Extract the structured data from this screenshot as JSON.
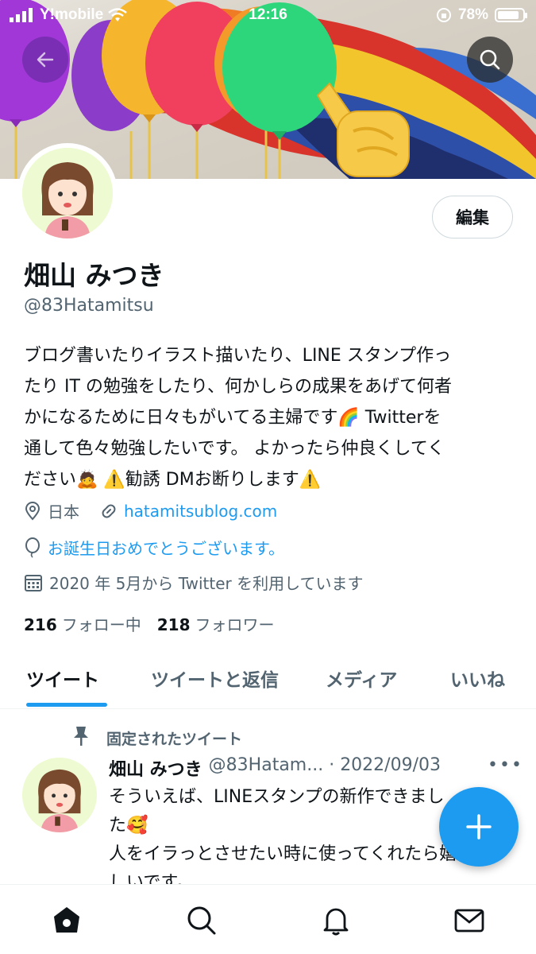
{
  "status": {
    "carrier": "Y!mobile",
    "time": "12:16",
    "battery": "78%",
    "battery_level": 0.78
  },
  "profile": {
    "name": "畑山 みつき",
    "handle": "@83Hatamitsu",
    "edit_label": "編集",
    "bio_lines": [
      "ブログ書いたりイラスト描いたり、LINE スタンプ作っ",
      "たり IT の勉強をしたり、何かしらの成果をあげて何者",
      "かになるために日々もがいてる主婦です🌈 Twitterを",
      "通して色々勉強したいです。 よかったら仲良くしてく",
      "ださい🙇 ⚠️勧誘 DMお断りします⚠️"
    ],
    "location": "日本",
    "website": "hatamitsublog.com",
    "birthday": "お誕生日おめでとうございます。",
    "joined": "2020 年 5月から Twitter を利用しています",
    "following_count": "216",
    "following_label": "フォロー中",
    "followers_count": "218",
    "followers_label": "フォロワー"
  },
  "tabs": [
    {
      "label": "ツイート",
      "active": true
    },
    {
      "label": "ツイートと返信",
      "active": false
    },
    {
      "label": "メディア",
      "active": false
    },
    {
      "label": "いいね",
      "active": false
    }
  ],
  "tweet": {
    "pinned_label": "固定されたツイート",
    "name": "畑山 みつき",
    "handle_date": "@83Hatam... · 2022/09/03",
    "more": "•••",
    "lines": [
      "そういえば、LINEスタンプの新作できまし",
      "た🥰",
      "人をイラっとさせたい時に使ってくれたら嬉",
      "しいです。"
    ]
  },
  "icons": {
    "back": "back-arrow-icon",
    "search": "search-icon",
    "location": "location-pin-icon",
    "link": "link-icon",
    "balloon": "balloon-icon",
    "calendar": "calendar-icon",
    "pin": "pin-icon",
    "compose": "plus-icon",
    "home": "home-icon",
    "explore": "search-icon",
    "notifications": "bell-icon",
    "messages": "mail-icon"
  },
  "colors": {
    "accent": "#1d9bf0",
    "text": "#0f1419",
    "secondary": "#536471"
  }
}
